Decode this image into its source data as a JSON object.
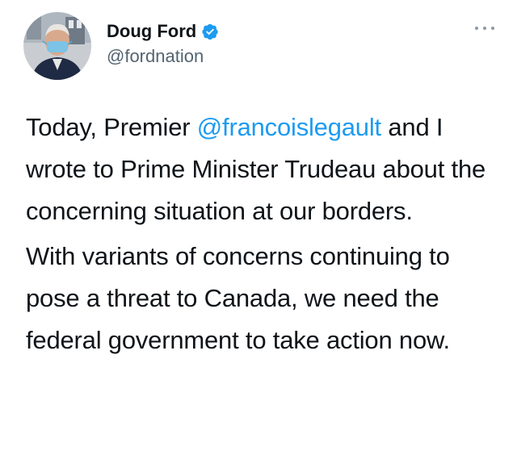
{
  "author": {
    "display_name": "Doug Ford",
    "handle": "@fordnation",
    "verified": true
  },
  "icons": {
    "verified": "verified-badge-icon",
    "more": "more-options-icon"
  },
  "colors": {
    "mention": "#1d9bf0",
    "verified": "#1d9bf0",
    "secondary_text": "#536471"
  },
  "tweet": {
    "p1_before": "Today, Premier ",
    "p1_mention": "@francoislegault",
    "p1_after": " and I wrote to Prime Minister Trudeau about the concerning situation at our borders.",
    "p2": "With variants of concerns continuing to pose a threat to Canada, we need the federal government to take action now."
  }
}
